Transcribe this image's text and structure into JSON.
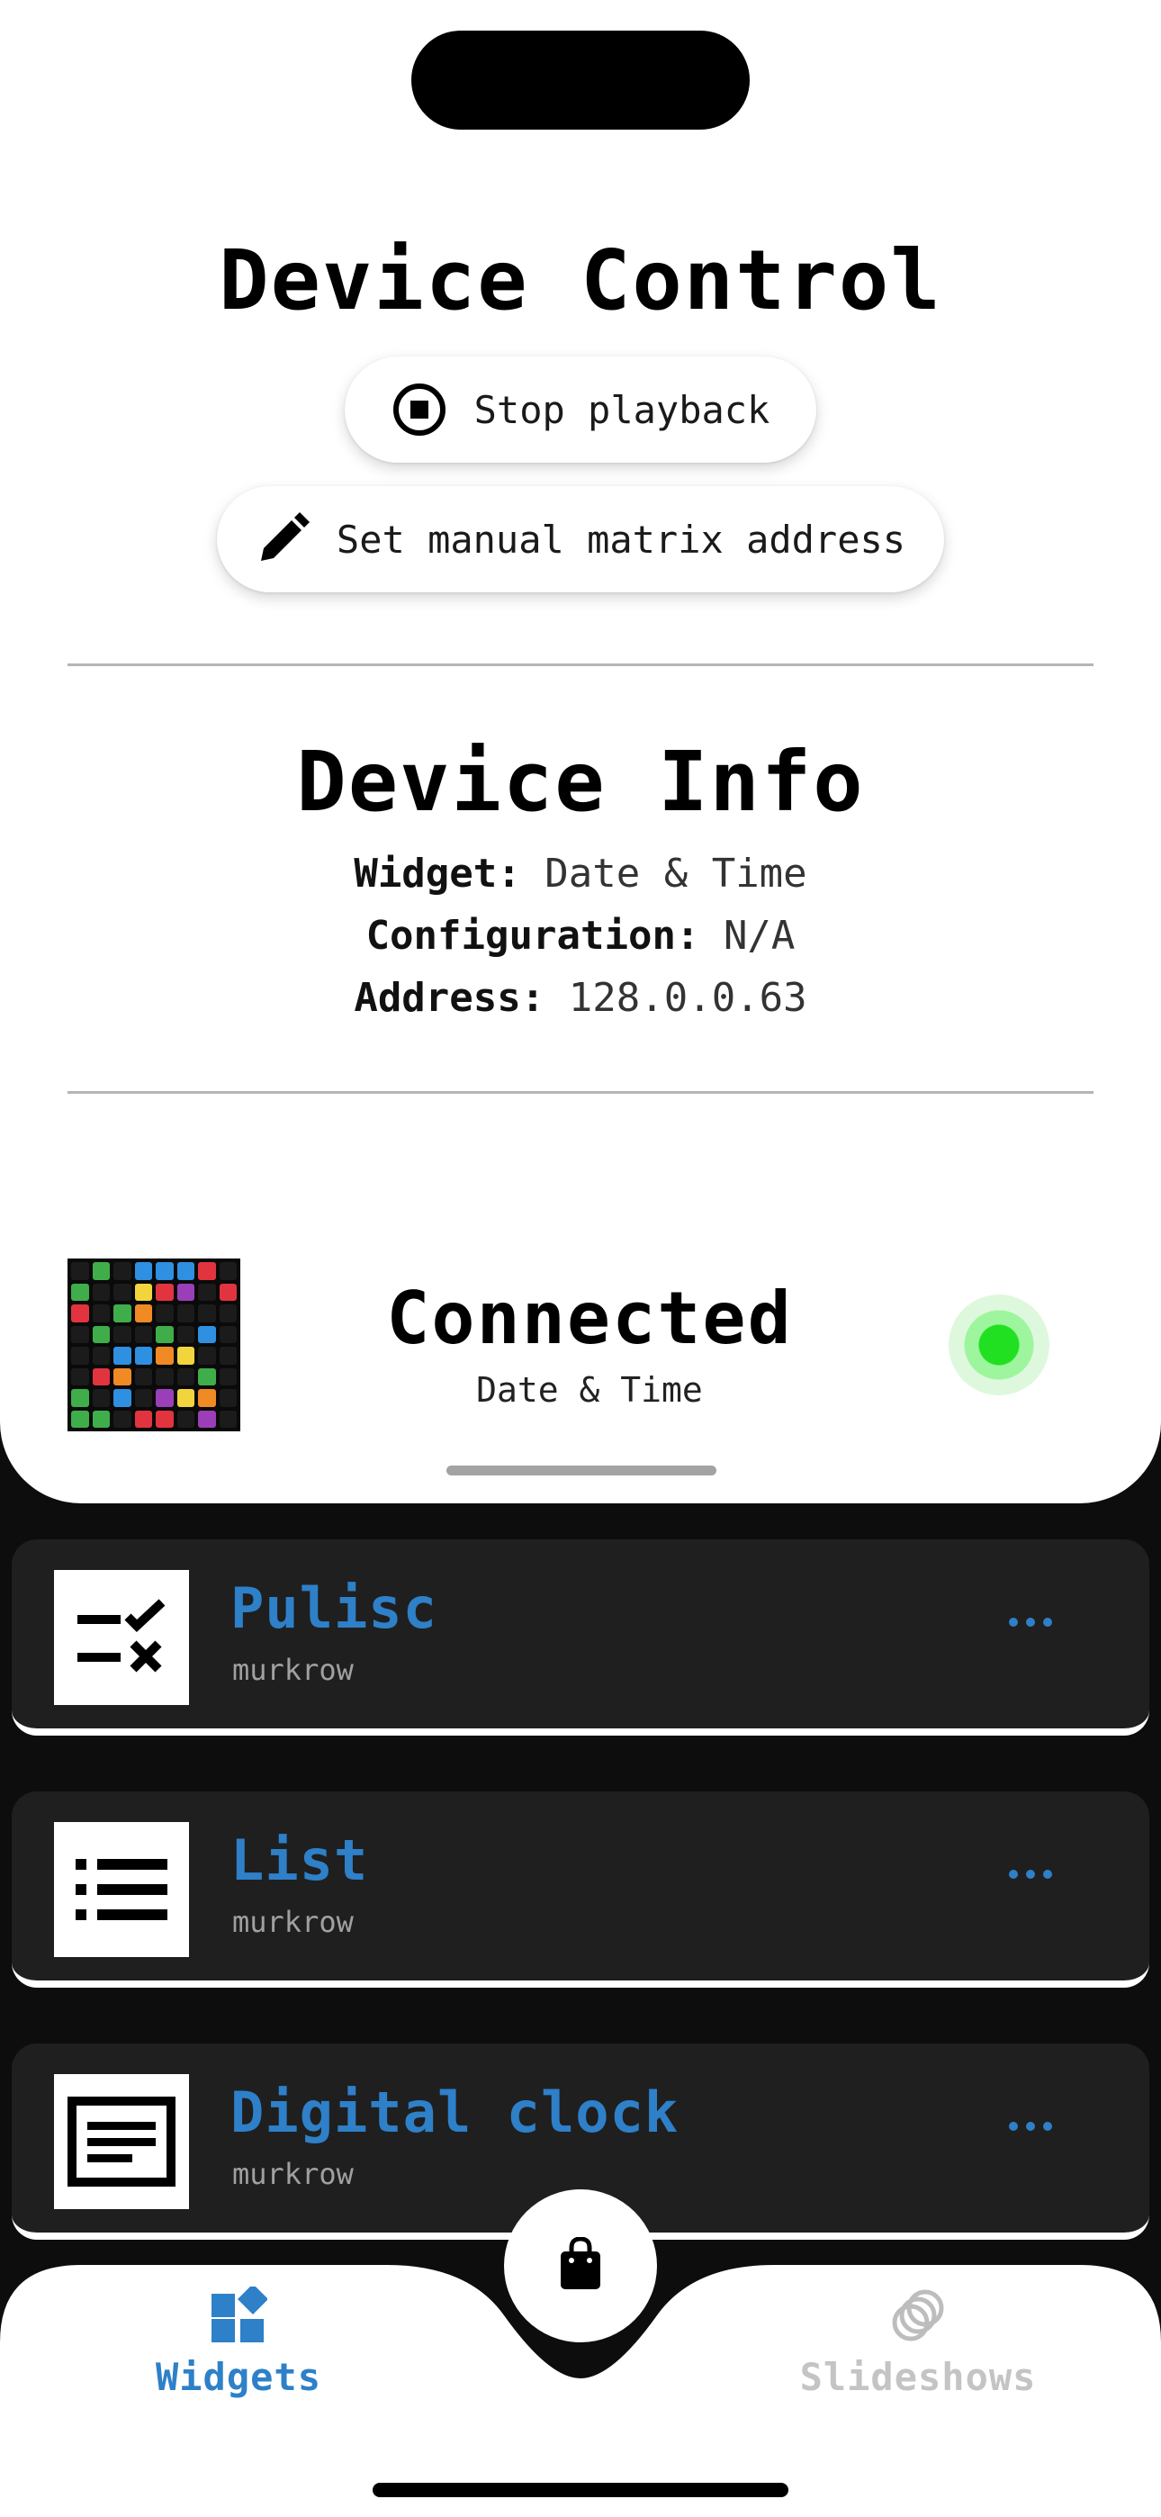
{
  "device_control": {
    "title": "Device Control",
    "stop_playback_label": "Stop playback",
    "manual_address_label": "Set manual matrix address"
  },
  "device_info": {
    "title": "Device Info",
    "widget_key": "Widget:",
    "widget_value": "Date & Time",
    "configuration_key": "Configuration:",
    "configuration_value": "N/A",
    "address_key": "Address:",
    "address_value": "128.0.0.63"
  },
  "connection": {
    "status": "Connected",
    "current_widget": "Date & Time",
    "status_color": "#21e021"
  },
  "widgets": [
    {
      "name": "Pulisc",
      "author": "murkrow",
      "icon": "checklist-icon"
    },
    {
      "name": "List",
      "author": "murkrow",
      "icon": "list-icon"
    },
    {
      "name": "Digital clock",
      "author": "murkrow",
      "icon": "digital-clock-icon"
    }
  ],
  "tabs": {
    "widgets_label": "Widgets",
    "slideshows_label": "Slideshows"
  },
  "colors": {
    "accent": "#2e80c8",
    "card_bg": "#1f1f1f",
    "background": "#0d0d0d"
  }
}
